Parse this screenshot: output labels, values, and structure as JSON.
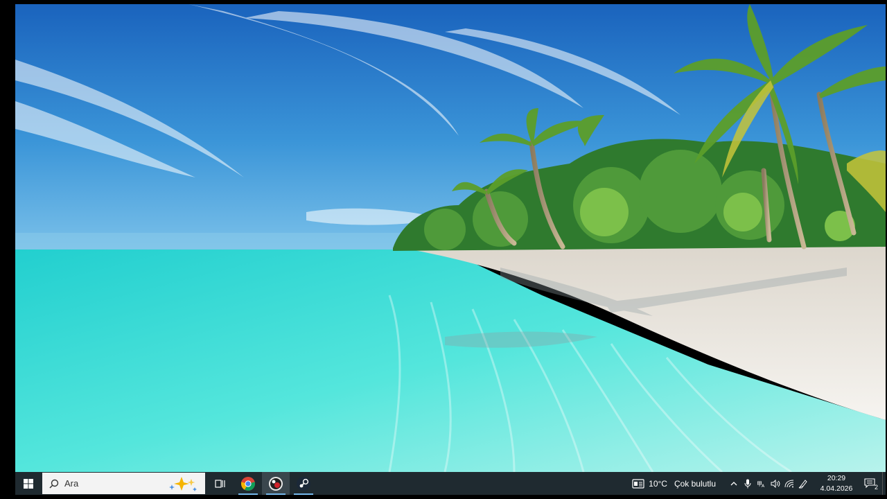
{
  "taskbar": {
    "search_placeholder": "Ara",
    "apps": [
      {
        "name": "Görev Görünümü",
        "icon": "task-view-icon",
        "active": false
      },
      {
        "name": "Google Chrome",
        "icon": "chrome-icon",
        "active": false
      },
      {
        "name": "App",
        "icon": "app-circle-icon",
        "active": true
      },
      {
        "name": "Steam",
        "icon": "steam-icon",
        "active": false
      }
    ],
    "weather": {
      "temperature": "10°C",
      "condition": "Çok bulutlu"
    },
    "clock": {
      "time": "20:29",
      "date": "4.04.2026"
    },
    "notification_count": "2"
  },
  "colors": {
    "taskbar_bg": "#1f2a30",
    "accent": "#76b9ed",
    "sky_top": "#1e6fc4",
    "sea": "#3fe0d8",
    "sand": "#ece9e3"
  }
}
